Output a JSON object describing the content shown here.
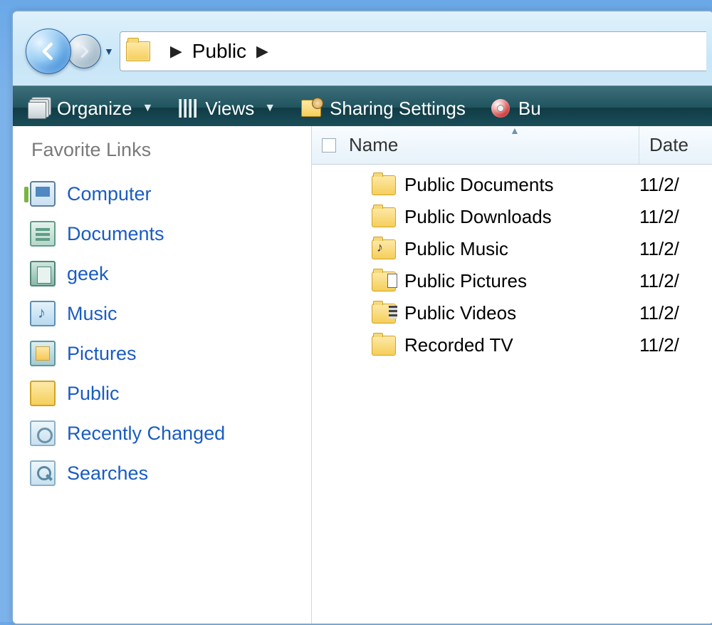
{
  "breadcrumb": {
    "current": "Public"
  },
  "toolbar": {
    "organize": "Organize",
    "views": "Views",
    "sharing": "Sharing Settings",
    "burn": "Bu"
  },
  "sidebar": {
    "title": "Favorite Links",
    "items": [
      {
        "label": "Computer",
        "icon": "computer"
      },
      {
        "label": "Documents",
        "icon": "docs"
      },
      {
        "label": "geek",
        "icon": "geek"
      },
      {
        "label": "Music",
        "icon": "music"
      },
      {
        "label": "Pictures",
        "icon": "pictures"
      },
      {
        "label": "Public",
        "icon": "public"
      },
      {
        "label": "Recently Changed",
        "icon": "recent"
      },
      {
        "label": "Searches",
        "icon": "searches"
      }
    ]
  },
  "columns": {
    "name": "Name",
    "date": "Date "
  },
  "files": [
    {
      "name": "Public Documents",
      "icon": "docs",
      "date": "11/2/"
    },
    {
      "name": "Public Downloads",
      "icon": "plain",
      "date": "11/2/"
    },
    {
      "name": "Public Music",
      "icon": "music",
      "date": "11/2/"
    },
    {
      "name": "Public Pictures",
      "icon": "pics",
      "date": "11/2/"
    },
    {
      "name": "Public Videos",
      "icon": "vids",
      "date": "11/2/"
    },
    {
      "name": "Recorded TV",
      "icon": "plain",
      "date": "11/2/"
    }
  ]
}
